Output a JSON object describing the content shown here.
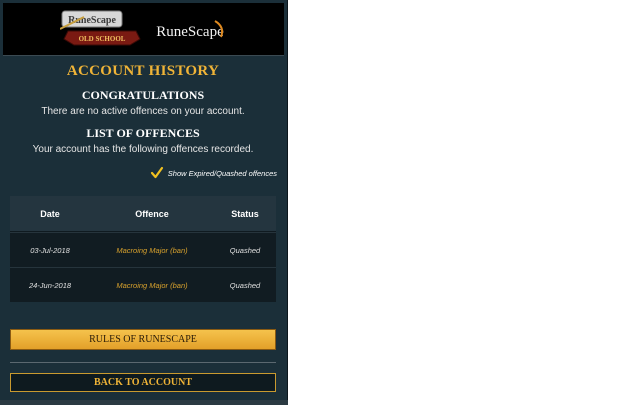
{
  "header": {
    "logo_osrs_text": "OLD SCHOOL",
    "logo_osrs_top": "RuneScape",
    "logo_rs_text": "RuneScape"
  },
  "page": {
    "title": "ACCOUNT HISTORY"
  },
  "congrats": {
    "heading": "CONGRATULATIONS",
    "text": "There are no active offences on your account."
  },
  "offences": {
    "heading": "LIST OF OFFENCES",
    "text": "Your account has the following offences recorded.",
    "checkbox_label": "Show Expired/Quashed offences",
    "checkbox_checked": true
  },
  "table": {
    "columns": [
      "Date",
      "Offence",
      "Status"
    ],
    "rows": [
      {
        "date": "03-Jul-2018",
        "offence": "Macroing Major (ban)",
        "status": "Quashed"
      },
      {
        "date": "24-Jun-2018",
        "offence": "Macroing Major (ban)",
        "status": "Quashed"
      }
    ]
  },
  "buttons": {
    "rules": "RULES OF RUNESCAPE",
    "back": "BACK TO ACCOUNT"
  },
  "colors": {
    "background": "#1b2f39",
    "accent": "#f0b437",
    "header": "#000000"
  },
  "icons": {
    "osrs_logo": "old-school-runescape-logo",
    "rs_logo": "runescape-logo",
    "check": "checkmark-icon"
  }
}
